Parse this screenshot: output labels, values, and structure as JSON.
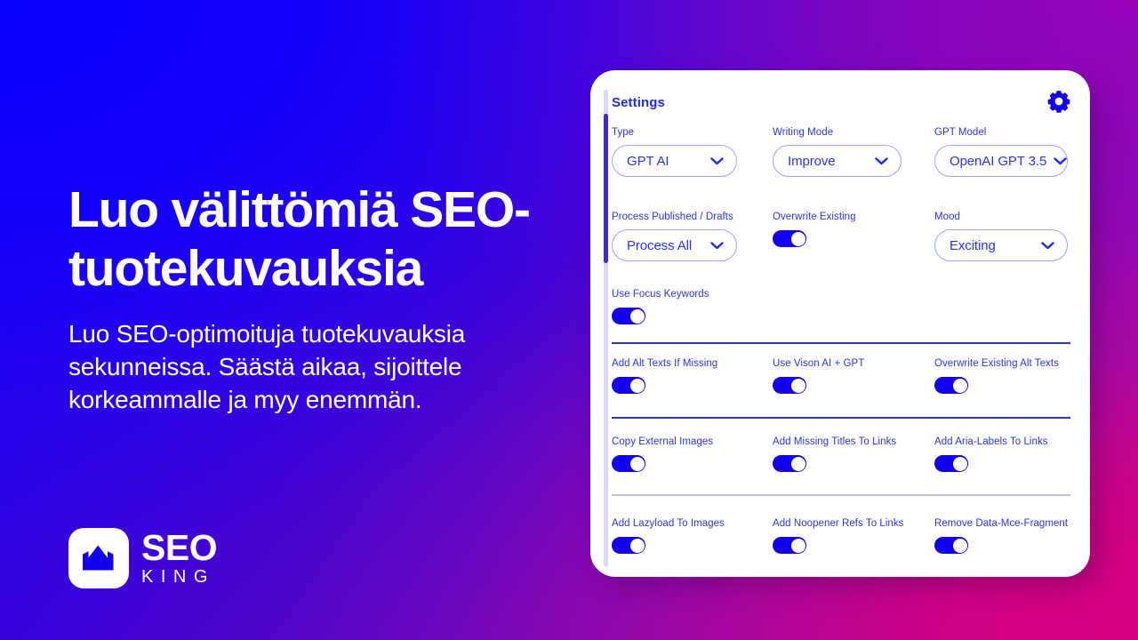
{
  "background": {
    "gradient_from": "#1400FF",
    "gradient_mid": "#7A07B8",
    "gradient_to": "#C50F8F"
  },
  "hero": {
    "headline": "Luo välittömiä SEO-tuotekuvauksia",
    "subhead": "Luo SEO-optimoituja tuotekuvauksia sekunneissa. Säästä aikaa, sijoittele korkeammalle ja myy enemmän.",
    "logo": {
      "mark_icon": "bar-chart-crown-icon",
      "primary": "SEO",
      "secondary": "KING",
      "mark_bg": "#FFFFFF",
      "mark_fg": "#1400F0"
    }
  },
  "panel": {
    "title": "Settings",
    "gear_icon": "gear-icon",
    "accent": "#1E2BE8",
    "toggle_on_color": "#1400F0",
    "row1": [
      {
        "label": "Type",
        "control": "select",
        "value": "GPT AI"
      },
      {
        "label": "Writing Mode",
        "control": "select",
        "value": "Improve"
      },
      {
        "label": "GPT Model",
        "control": "select",
        "value": "OpenAI GPT 3.5"
      }
    ],
    "row2": [
      {
        "label": "Process Published / Drafts",
        "control": "select",
        "value": "Process All"
      },
      {
        "label": "Overwrite Existing",
        "control": "toggle",
        "value": "on"
      },
      {
        "label": "Mood",
        "control": "select",
        "value": "Exciting"
      }
    ],
    "row3": [
      {
        "label": "Use Focus Keywords",
        "control": "toggle",
        "value": "on"
      }
    ],
    "row4": [
      {
        "label": "Add Alt Texts If Missing",
        "control": "toggle",
        "value": "on"
      },
      {
        "label": "Use Vison AI + GPT",
        "control": "toggle",
        "value": "on"
      },
      {
        "label": "Overwrite Existing Alt Texts",
        "control": "toggle",
        "value": "on"
      }
    ],
    "row5": [
      {
        "label": "Copy External Images",
        "control": "toggle",
        "value": "on"
      },
      {
        "label": "Add Missing Titles To Links",
        "control": "toggle",
        "value": "on"
      },
      {
        "label": "Add Aria-Labels To Links",
        "control": "toggle",
        "value": "on"
      }
    ],
    "row6": [
      {
        "label": "Add Lazyload To Images",
        "control": "toggle",
        "value": "on"
      },
      {
        "label": "Add Noopener Refs To Links",
        "control": "toggle",
        "value": "on"
      },
      {
        "label": "Remove Data-Mce-Fragment",
        "control": "toggle",
        "value": "on"
      }
    ],
    "scrollbar": {
      "orientation": "vertical",
      "position": "left"
    }
  }
}
